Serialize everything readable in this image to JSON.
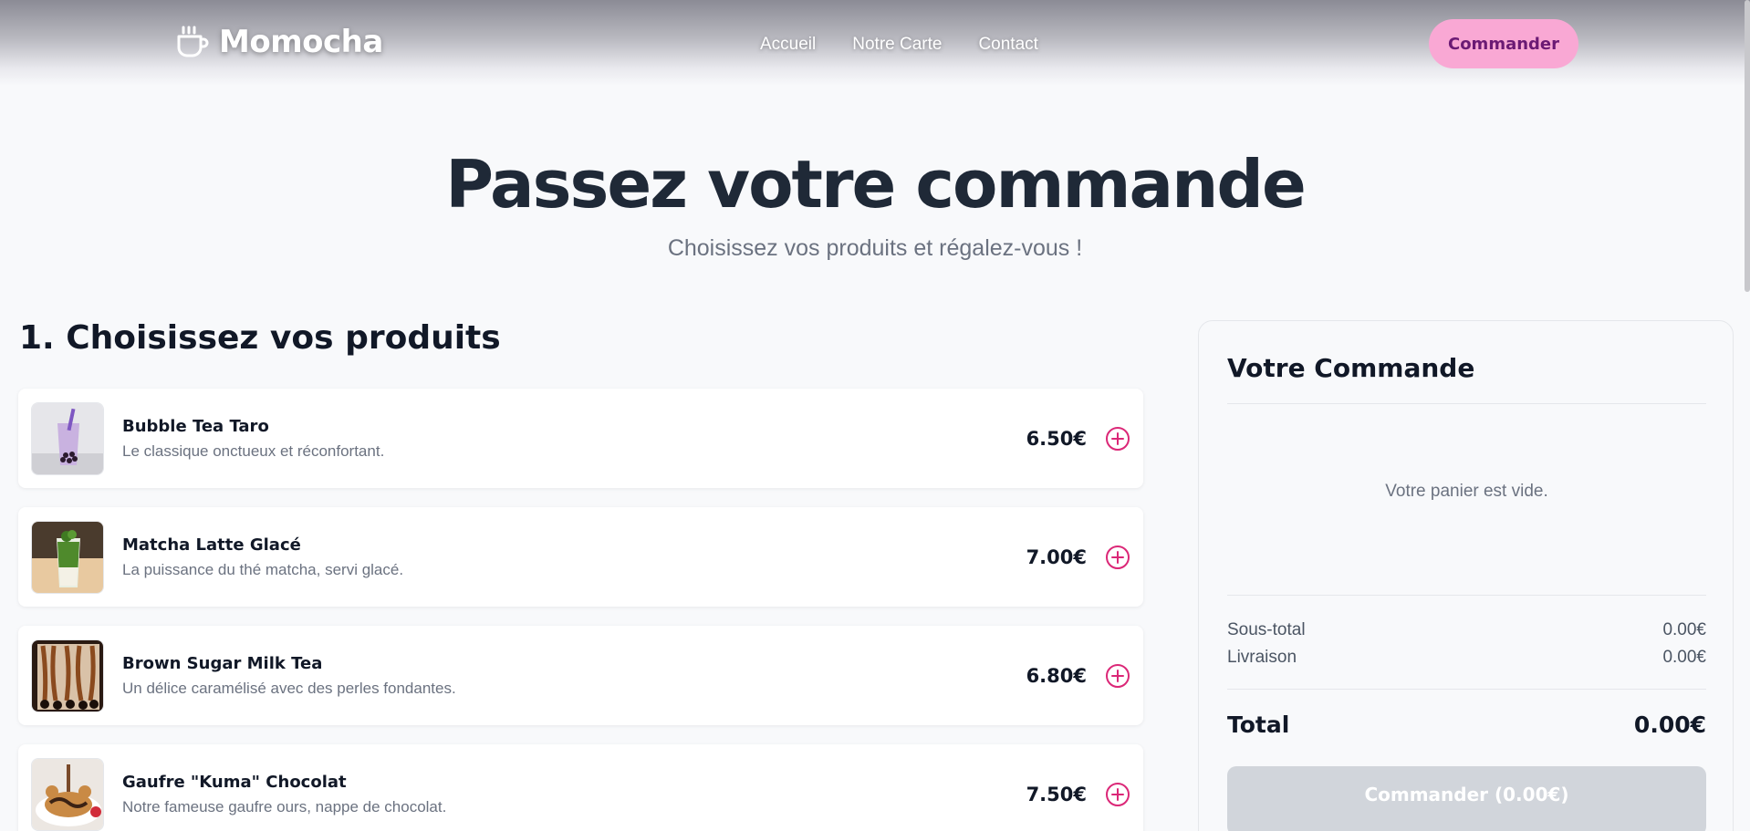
{
  "header": {
    "brand": "Momocha",
    "nav": [
      "Accueil",
      "Notre Carte",
      "Contact"
    ],
    "cta_label": "Commander",
    "colors": {
      "cta_bg": "#f9a8d4",
      "cta_text": "#6b1a74",
      "accent": "#db2777"
    }
  },
  "hero": {
    "title": "Passez votre commande",
    "subtitle": "Choisissez vos produits et régalez-vous !"
  },
  "products": {
    "section_title": "1. Choisissez vos produits",
    "items": [
      {
        "name": "Bubble Tea Taro",
        "description": "Le classique onctueux et réconfortant.",
        "price": "6.50€"
      },
      {
        "name": "Matcha Latte Glacé",
        "description": "La puissance du thé matcha, servi glacé.",
        "price": "7.00€"
      },
      {
        "name": "Brown Sugar Milk Tea",
        "description": "Un délice caramélisé avec des perles fondantes.",
        "price": "6.80€"
      },
      {
        "name": "Gaufre \"Kuma\" Chocolat",
        "description": "Notre fameuse gaufre ours, nappe de chocolat.",
        "price": "7.50€"
      }
    ]
  },
  "order": {
    "title": "Votre Commande",
    "empty_message": "Votre panier est vide.",
    "subtotal_label": "Sous-total",
    "subtotal_value": "0.00€",
    "delivery_label": "Livraison",
    "delivery_value": "0.00€",
    "total_label": "Total",
    "total_value": "0.00€",
    "submit_label": "Commander (0.00€)"
  }
}
